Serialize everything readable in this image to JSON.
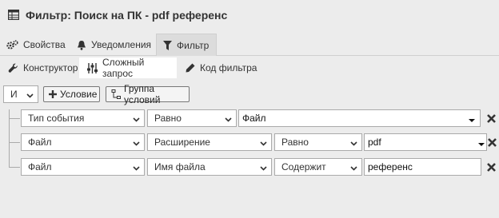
{
  "header": {
    "title": "Фильтр: Поиск на ПК - pdf референс",
    "icon": "table-icon"
  },
  "tabs": [
    {
      "label": "Свойства",
      "icon": "gears-icon"
    },
    {
      "label": "Уведомления",
      "icon": "bell-icon"
    },
    {
      "label": "Фильтр",
      "icon": "filter-icon",
      "active": true
    }
  ],
  "subtabs": [
    {
      "label": "Конструктор",
      "icon": "wrench-icon"
    },
    {
      "label": "Сложный запрос",
      "icon": "sliders-icon",
      "active": true
    },
    {
      "label": "Код фильтра",
      "icon": "pencil-icon"
    }
  ],
  "toolbar": {
    "logic_value": "И",
    "add_condition_label": "Условие",
    "add_group_label": "Группа условий"
  },
  "rows": [
    {
      "field": "Тип события",
      "operator": "Равно",
      "value": "Файл"
    },
    {
      "field": "Файл",
      "sub_field": "Расширение",
      "operator": "Равно",
      "value": "pdf"
    },
    {
      "field": "Файл",
      "sub_field": "Имя файла",
      "operator": "Содержит",
      "value": "референс"
    }
  ],
  "colors": {
    "background": "#ececec",
    "active_tab": "#dcdcdc",
    "input_border": "#aaaaaa"
  }
}
